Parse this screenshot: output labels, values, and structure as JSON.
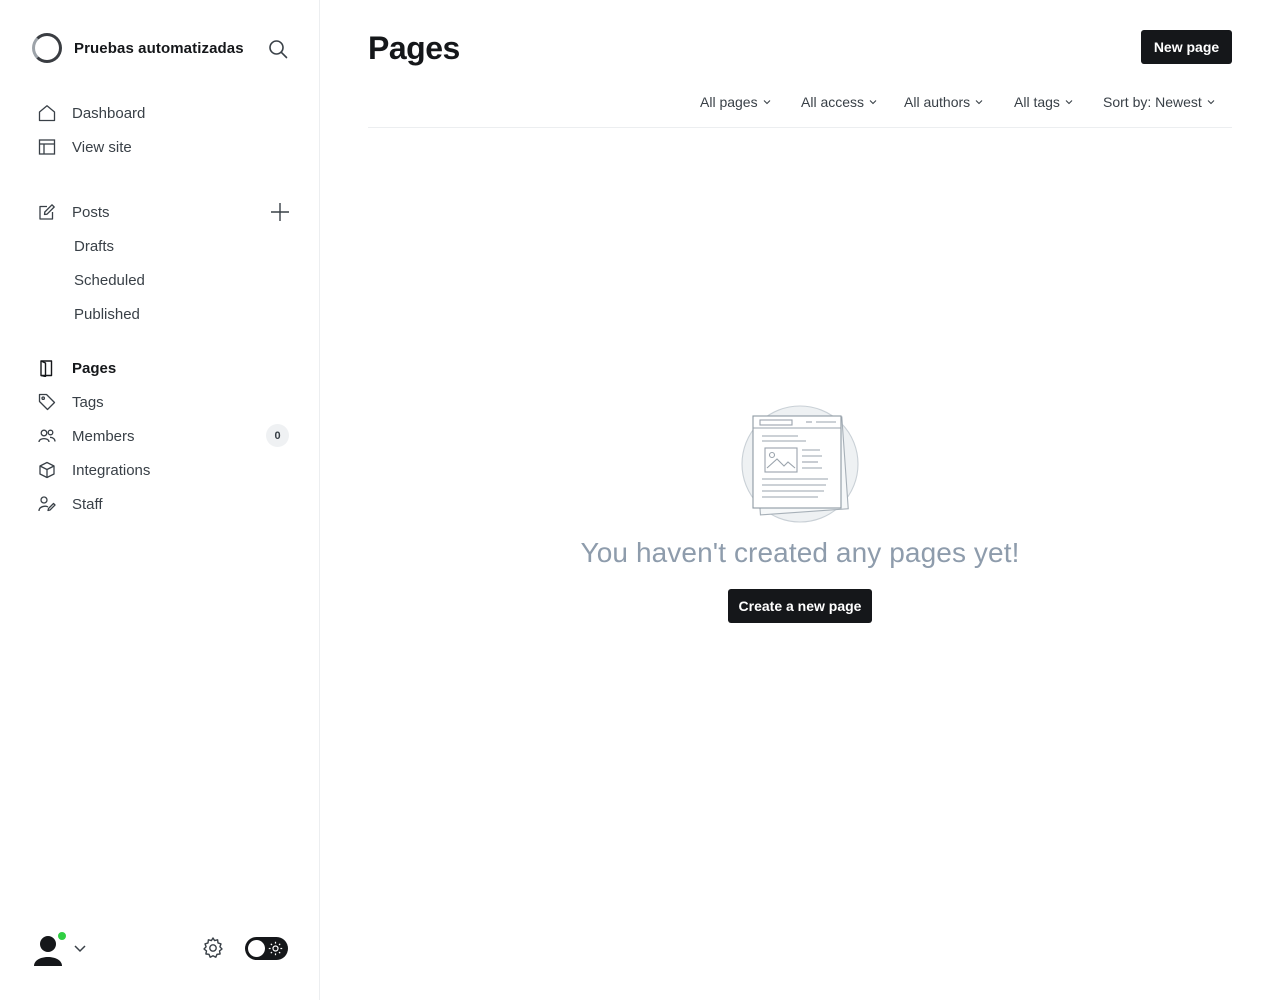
{
  "site": {
    "name": "Pruebas automatizadas"
  },
  "sidebar": {
    "primary": [
      {
        "label": "Dashboard",
        "icon": "home-icon"
      },
      {
        "label": "View site",
        "icon": "layout-icon"
      }
    ],
    "posts": {
      "label": "Posts",
      "icon": "edit-icon",
      "sub": [
        "Drafts",
        "Scheduled",
        "Published"
      ]
    },
    "secondary": [
      {
        "label": "Pages",
        "icon": "page-icon",
        "active": true
      },
      {
        "label": "Tags",
        "icon": "tag-icon"
      },
      {
        "label": "Members",
        "icon": "members-icon",
        "badge": "0"
      },
      {
        "label": "Integrations",
        "icon": "box-icon"
      },
      {
        "label": "Staff",
        "icon": "staff-icon"
      }
    ]
  },
  "header": {
    "title": "Pages",
    "new_button": "New page"
  },
  "filters": {
    "type": "All pages",
    "access": "All access",
    "authors": "All authors",
    "tags": "All tags",
    "sort": "Sort by: Newest"
  },
  "empty_state": {
    "message": "You haven't created any pages yet!",
    "button": "Create a new page"
  },
  "colors": {
    "accent_dark": "#15171a",
    "online": "#30cf43",
    "muted_text": "#8e9cac"
  }
}
